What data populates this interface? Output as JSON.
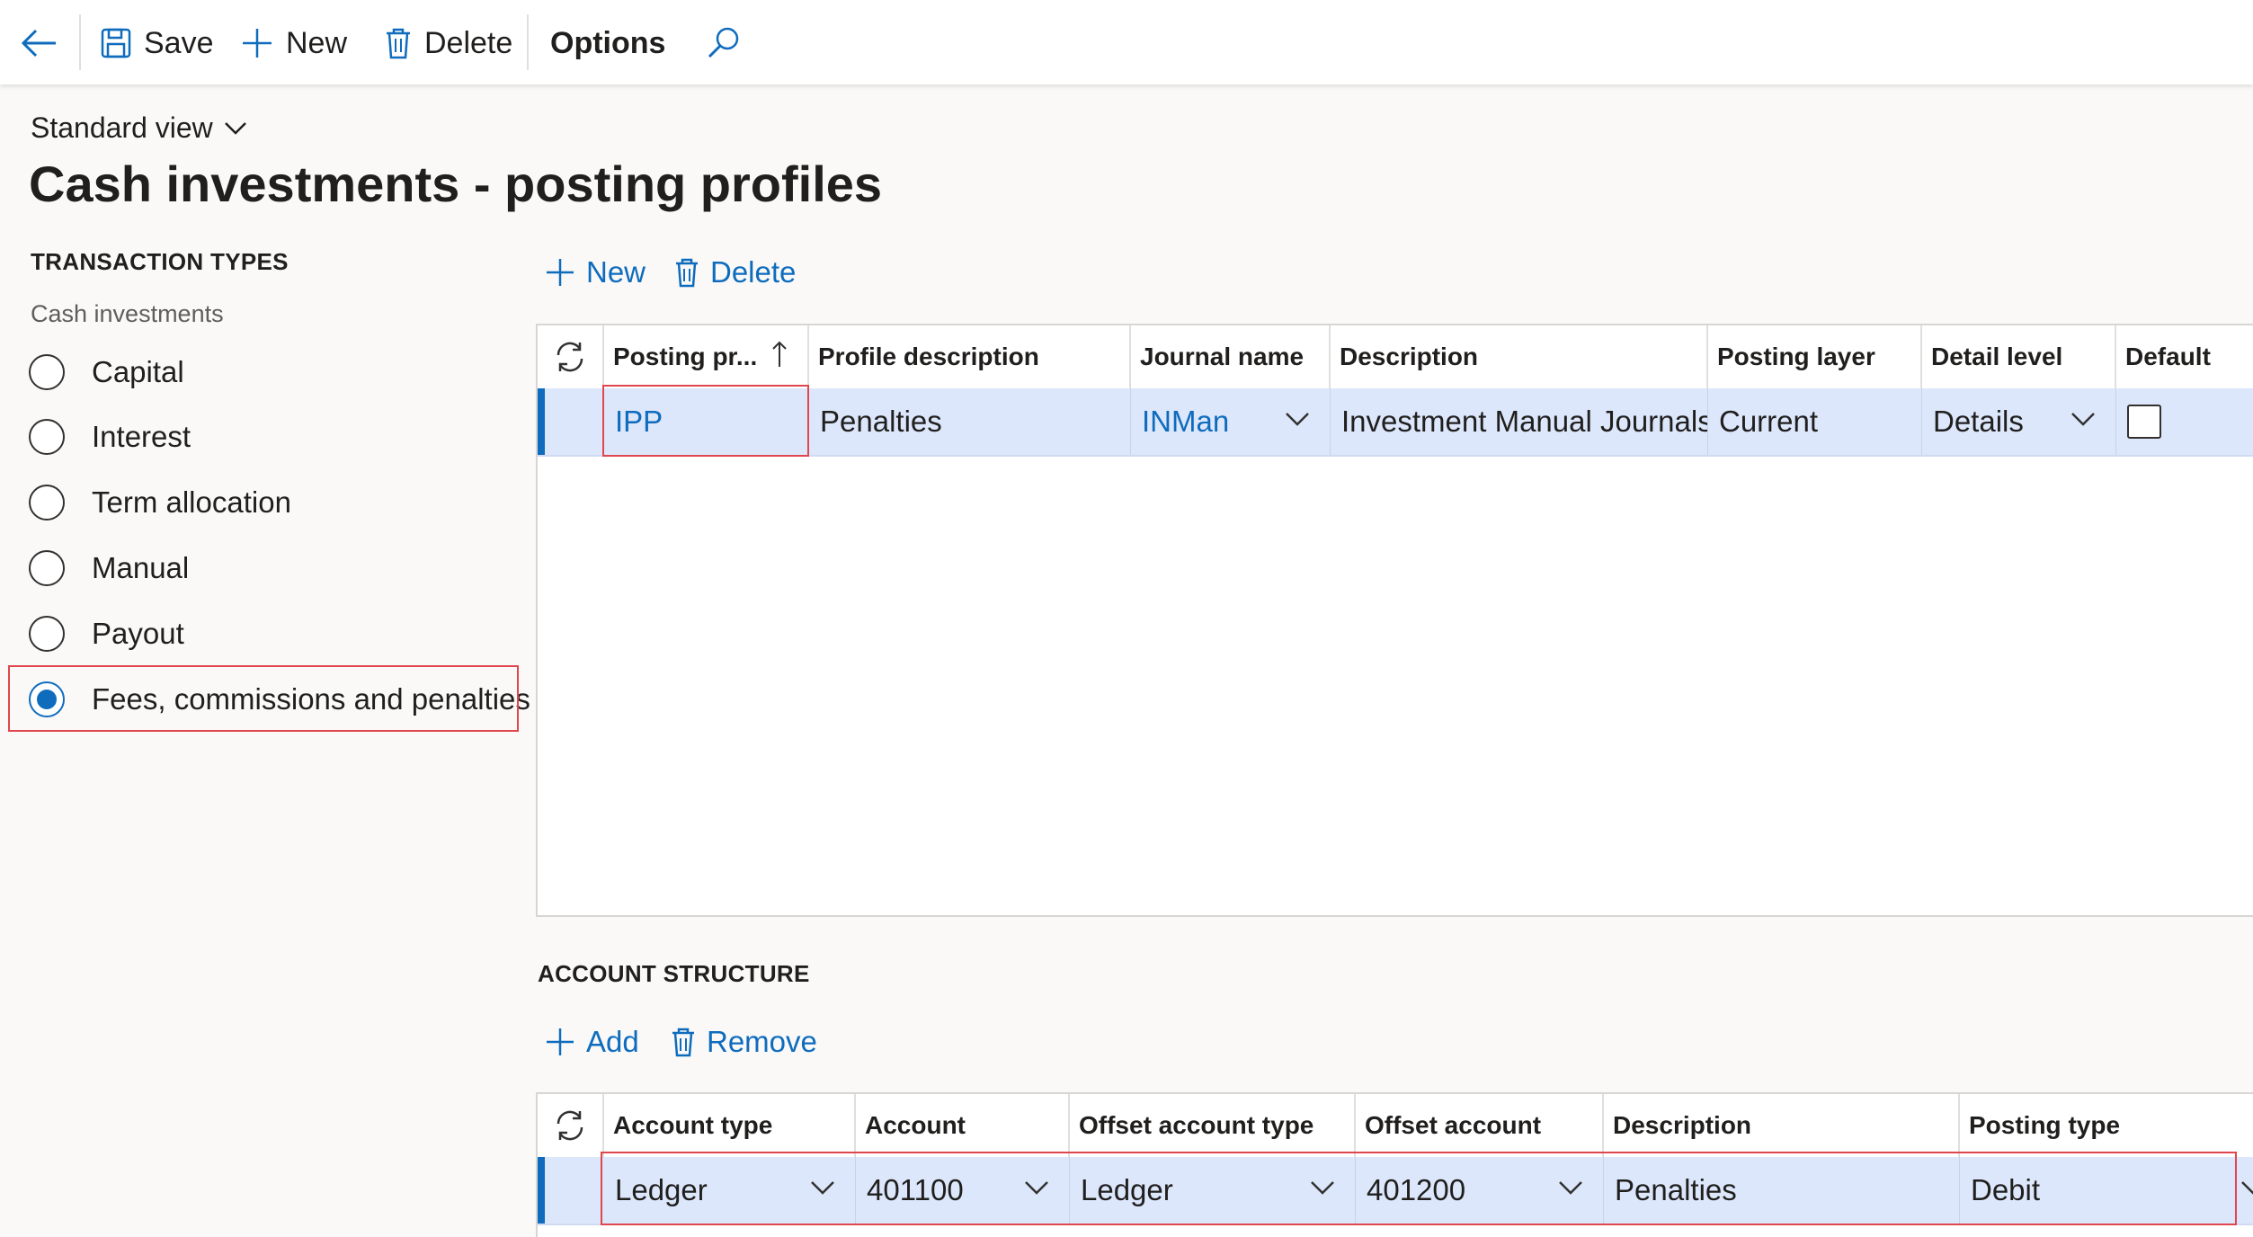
{
  "toolbar": {
    "back_label": "Back",
    "save_label": "Save",
    "new_label": "New",
    "delete_label": "Delete",
    "options_label": "Options"
  },
  "page": {
    "view_label": "Standard view",
    "title": "Cash investments - posting profiles"
  },
  "transaction_types": {
    "heading": "TRANSACTION TYPES",
    "group_label": "Cash investments",
    "selected": "Fees, commissions and penalties",
    "options": [
      {
        "label": "Capital"
      },
      {
        "label": "Interest"
      },
      {
        "label": "Term allocation"
      },
      {
        "label": "Manual"
      },
      {
        "label": "Payout"
      },
      {
        "label": "Fees, commissions and penalties"
      }
    ]
  },
  "profiles_grid": {
    "actions": {
      "new_label": "New",
      "delete_label": "Delete"
    },
    "columns": [
      "Posting pr...",
      "Profile description",
      "Journal name",
      "Description",
      "Posting layer",
      "Detail level",
      "Default"
    ],
    "sort_column": "Posting pr...",
    "sort_direction": "ascending",
    "rows": [
      {
        "posting_profile": "IPP",
        "profile_description": "Penalties",
        "journal_name": "INMan",
        "description": "Investment Manual Journals",
        "posting_layer": "Current",
        "detail_level": "Details",
        "default": false
      }
    ]
  },
  "account_structure": {
    "heading": "ACCOUNT STRUCTURE",
    "actions": {
      "add_label": "Add",
      "remove_label": "Remove"
    },
    "columns": [
      "Account type",
      "Account",
      "Offset account type",
      "Offset account",
      "Description",
      "Posting type"
    ],
    "rows": [
      {
        "account_type": "Ledger",
        "account": "401100",
        "offset_account_type": "Ledger",
        "offset_account": "401200",
        "description": "Penalties",
        "posting_type": "Debit"
      }
    ]
  },
  "colors": {
    "accent": "#0f6cbd",
    "selected_row": "#dde7fb",
    "highlight_box": "#e0464d",
    "page_background": "#faf9f8"
  },
  "icons": [
    "back-arrow-icon",
    "save-icon",
    "plus-icon",
    "trash-icon",
    "search-icon",
    "chevron-down-icon",
    "sort-up-arrow-icon",
    "refresh-icon"
  ]
}
